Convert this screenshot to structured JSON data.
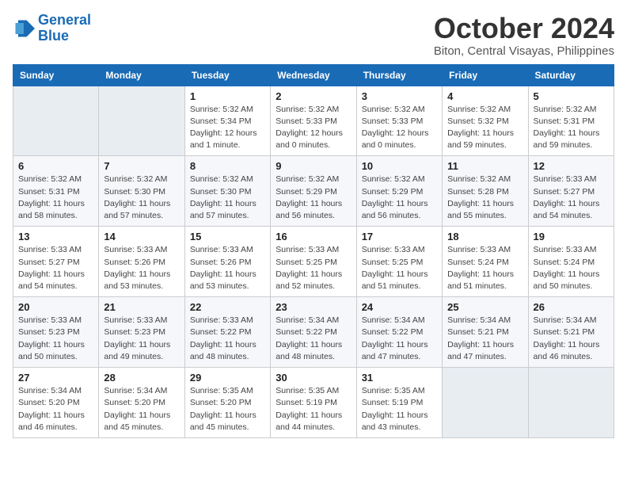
{
  "logo": {
    "line1": "General",
    "line2": "Blue"
  },
  "title": "October 2024",
  "location": "Biton, Central Visayas, Philippines",
  "weekdays": [
    "Sunday",
    "Monday",
    "Tuesday",
    "Wednesday",
    "Thursday",
    "Friday",
    "Saturday"
  ],
  "weeks": [
    [
      {
        "day": "",
        "detail": ""
      },
      {
        "day": "",
        "detail": ""
      },
      {
        "day": "1",
        "detail": "Sunrise: 5:32 AM\nSunset: 5:34 PM\nDaylight: 12 hours\nand 1 minute."
      },
      {
        "day": "2",
        "detail": "Sunrise: 5:32 AM\nSunset: 5:33 PM\nDaylight: 12 hours\nand 0 minutes."
      },
      {
        "day": "3",
        "detail": "Sunrise: 5:32 AM\nSunset: 5:33 PM\nDaylight: 12 hours\nand 0 minutes."
      },
      {
        "day": "4",
        "detail": "Sunrise: 5:32 AM\nSunset: 5:32 PM\nDaylight: 11 hours\nand 59 minutes."
      },
      {
        "day": "5",
        "detail": "Sunrise: 5:32 AM\nSunset: 5:31 PM\nDaylight: 11 hours\nand 59 minutes."
      }
    ],
    [
      {
        "day": "6",
        "detail": "Sunrise: 5:32 AM\nSunset: 5:31 PM\nDaylight: 11 hours\nand 58 minutes."
      },
      {
        "day": "7",
        "detail": "Sunrise: 5:32 AM\nSunset: 5:30 PM\nDaylight: 11 hours\nand 57 minutes."
      },
      {
        "day": "8",
        "detail": "Sunrise: 5:32 AM\nSunset: 5:30 PM\nDaylight: 11 hours\nand 57 minutes."
      },
      {
        "day": "9",
        "detail": "Sunrise: 5:32 AM\nSunset: 5:29 PM\nDaylight: 11 hours\nand 56 minutes."
      },
      {
        "day": "10",
        "detail": "Sunrise: 5:32 AM\nSunset: 5:29 PM\nDaylight: 11 hours\nand 56 minutes."
      },
      {
        "day": "11",
        "detail": "Sunrise: 5:32 AM\nSunset: 5:28 PM\nDaylight: 11 hours\nand 55 minutes."
      },
      {
        "day": "12",
        "detail": "Sunrise: 5:33 AM\nSunset: 5:27 PM\nDaylight: 11 hours\nand 54 minutes."
      }
    ],
    [
      {
        "day": "13",
        "detail": "Sunrise: 5:33 AM\nSunset: 5:27 PM\nDaylight: 11 hours\nand 54 minutes."
      },
      {
        "day": "14",
        "detail": "Sunrise: 5:33 AM\nSunset: 5:26 PM\nDaylight: 11 hours\nand 53 minutes."
      },
      {
        "day": "15",
        "detail": "Sunrise: 5:33 AM\nSunset: 5:26 PM\nDaylight: 11 hours\nand 53 minutes."
      },
      {
        "day": "16",
        "detail": "Sunrise: 5:33 AM\nSunset: 5:25 PM\nDaylight: 11 hours\nand 52 minutes."
      },
      {
        "day": "17",
        "detail": "Sunrise: 5:33 AM\nSunset: 5:25 PM\nDaylight: 11 hours\nand 51 minutes."
      },
      {
        "day": "18",
        "detail": "Sunrise: 5:33 AM\nSunset: 5:24 PM\nDaylight: 11 hours\nand 51 minutes."
      },
      {
        "day": "19",
        "detail": "Sunrise: 5:33 AM\nSunset: 5:24 PM\nDaylight: 11 hours\nand 50 minutes."
      }
    ],
    [
      {
        "day": "20",
        "detail": "Sunrise: 5:33 AM\nSunset: 5:23 PM\nDaylight: 11 hours\nand 50 minutes."
      },
      {
        "day": "21",
        "detail": "Sunrise: 5:33 AM\nSunset: 5:23 PM\nDaylight: 11 hours\nand 49 minutes."
      },
      {
        "day": "22",
        "detail": "Sunrise: 5:33 AM\nSunset: 5:22 PM\nDaylight: 11 hours\nand 48 minutes."
      },
      {
        "day": "23",
        "detail": "Sunrise: 5:34 AM\nSunset: 5:22 PM\nDaylight: 11 hours\nand 48 minutes."
      },
      {
        "day": "24",
        "detail": "Sunrise: 5:34 AM\nSunset: 5:22 PM\nDaylight: 11 hours\nand 47 minutes."
      },
      {
        "day": "25",
        "detail": "Sunrise: 5:34 AM\nSunset: 5:21 PM\nDaylight: 11 hours\nand 47 minutes."
      },
      {
        "day": "26",
        "detail": "Sunrise: 5:34 AM\nSunset: 5:21 PM\nDaylight: 11 hours\nand 46 minutes."
      }
    ],
    [
      {
        "day": "27",
        "detail": "Sunrise: 5:34 AM\nSunset: 5:20 PM\nDaylight: 11 hours\nand 46 minutes."
      },
      {
        "day": "28",
        "detail": "Sunrise: 5:34 AM\nSunset: 5:20 PM\nDaylight: 11 hours\nand 45 minutes."
      },
      {
        "day": "29",
        "detail": "Sunrise: 5:35 AM\nSunset: 5:20 PM\nDaylight: 11 hours\nand 45 minutes."
      },
      {
        "day": "30",
        "detail": "Sunrise: 5:35 AM\nSunset: 5:19 PM\nDaylight: 11 hours\nand 44 minutes."
      },
      {
        "day": "31",
        "detail": "Sunrise: 5:35 AM\nSunset: 5:19 PM\nDaylight: 11 hours\nand 43 minutes."
      },
      {
        "day": "",
        "detail": ""
      },
      {
        "day": "",
        "detail": ""
      }
    ]
  ]
}
